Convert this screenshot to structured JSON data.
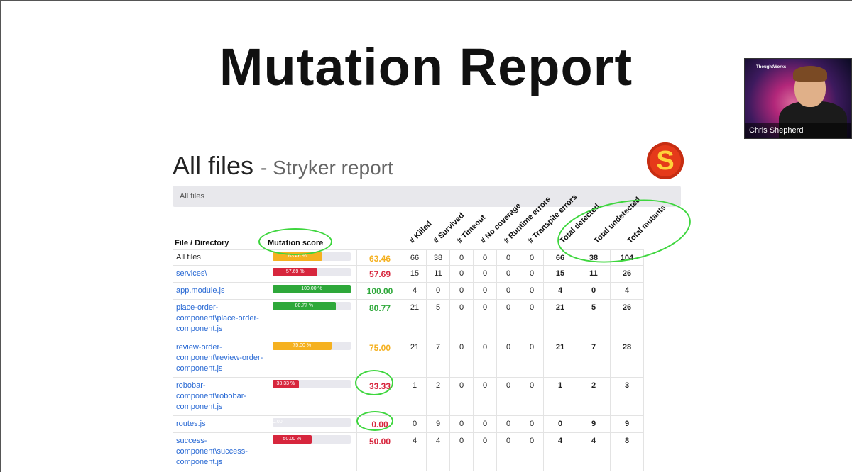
{
  "slide": {
    "title": "Mutation Report"
  },
  "webcam": {
    "brand": "ThoughtWorks",
    "participant_name": "Chris Shepherd"
  },
  "report": {
    "heading": "All files",
    "heading_suffix": "- Stryker report",
    "logo_letter": "S",
    "breadcrumb": "All files",
    "columns": {
      "file": "File / Directory",
      "mutation_score": "Mutation score",
      "killed": "# Killed",
      "survived": "# Survived",
      "timeout": "# Timeout",
      "no_coverage": "# No coverage",
      "runtime_errors": "# Runtime errors",
      "transpile_errors": "# Transpile errors",
      "total_detected": "Total detected",
      "total_undetected": "Total undetected",
      "total_mutants": "Total mutants"
    },
    "rows": [
      {
        "name": "All files",
        "link": false,
        "bar_label": "63.46 %",
        "score": "63.46",
        "score_value": 63.46,
        "color": "#f5b120",
        "killed": "66",
        "survived": "38",
        "timeout": "0",
        "no_coverage": "0",
        "runtime": "0",
        "transpile": "0",
        "detected": "66",
        "undetected": "38",
        "total": "104"
      },
      {
        "name": "services\\",
        "link": true,
        "bar_label": "57.69 %",
        "score": "57.69",
        "score_value": 57.69,
        "color": "#d7263d",
        "killed": "15",
        "survived": "11",
        "timeout": "0",
        "no_coverage": "0",
        "runtime": "0",
        "transpile": "0",
        "detected": "15",
        "undetected": "11",
        "total": "26"
      },
      {
        "name": "app.module.js",
        "link": true,
        "bar_label": "100.00 %",
        "score": "100.00",
        "score_value": 100,
        "color": "#2ea83a",
        "killed": "4",
        "survived": "0",
        "timeout": "0",
        "no_coverage": "0",
        "runtime": "0",
        "transpile": "0",
        "detected": "4",
        "undetected": "0",
        "total": "4"
      },
      {
        "name": "place-order-component\\place-order-component.js",
        "link": true,
        "bar_label": "80.77 %",
        "score": "80.77",
        "score_value": 80.77,
        "color": "#2ea83a",
        "killed": "21",
        "survived": "5",
        "timeout": "0",
        "no_coverage": "0",
        "runtime": "0",
        "transpile": "0",
        "detected": "21",
        "undetected": "5",
        "total": "26"
      },
      {
        "name": "review-order-component\\review-order-component.js",
        "link": true,
        "bar_label": "75.00 %",
        "score": "75.00",
        "score_value": 75,
        "color": "#f5b120",
        "killed": "21",
        "survived": "7",
        "timeout": "0",
        "no_coverage": "0",
        "runtime": "0",
        "transpile": "0",
        "detected": "21",
        "undetected": "7",
        "total": "28"
      },
      {
        "name": "robobar-component\\robobar-component.js",
        "link": true,
        "bar_label": "33.33 %",
        "score": "33.33",
        "score_value": 33.33,
        "color": "#d7263d",
        "killed": "1",
        "survived": "2",
        "timeout": "0",
        "no_coverage": "0",
        "runtime": "0",
        "transpile": "0",
        "detected": "1",
        "undetected": "2",
        "total": "3"
      },
      {
        "name": "routes.js",
        "link": true,
        "bar_label": "0.00 %",
        "score": "0.00",
        "score_value": 0,
        "color": "#d7263d",
        "killed": "0",
        "survived": "9",
        "timeout": "0",
        "no_coverage": "0",
        "runtime": "0",
        "transpile": "0",
        "detected": "0",
        "undetected": "9",
        "total": "9"
      },
      {
        "name": "success-component\\success-component.js",
        "link": true,
        "bar_label": "50.00 %",
        "score": "50.00",
        "score_value": 50,
        "color": "#d7263d",
        "killed": "4",
        "survived": "4",
        "timeout": "0",
        "no_coverage": "0",
        "runtime": "0",
        "transpile": "0",
        "detected": "4",
        "undetected": "4",
        "total": "8"
      }
    ]
  },
  "colors": {
    "annotation": "#3ed63e",
    "link": "#2a6ad4"
  }
}
